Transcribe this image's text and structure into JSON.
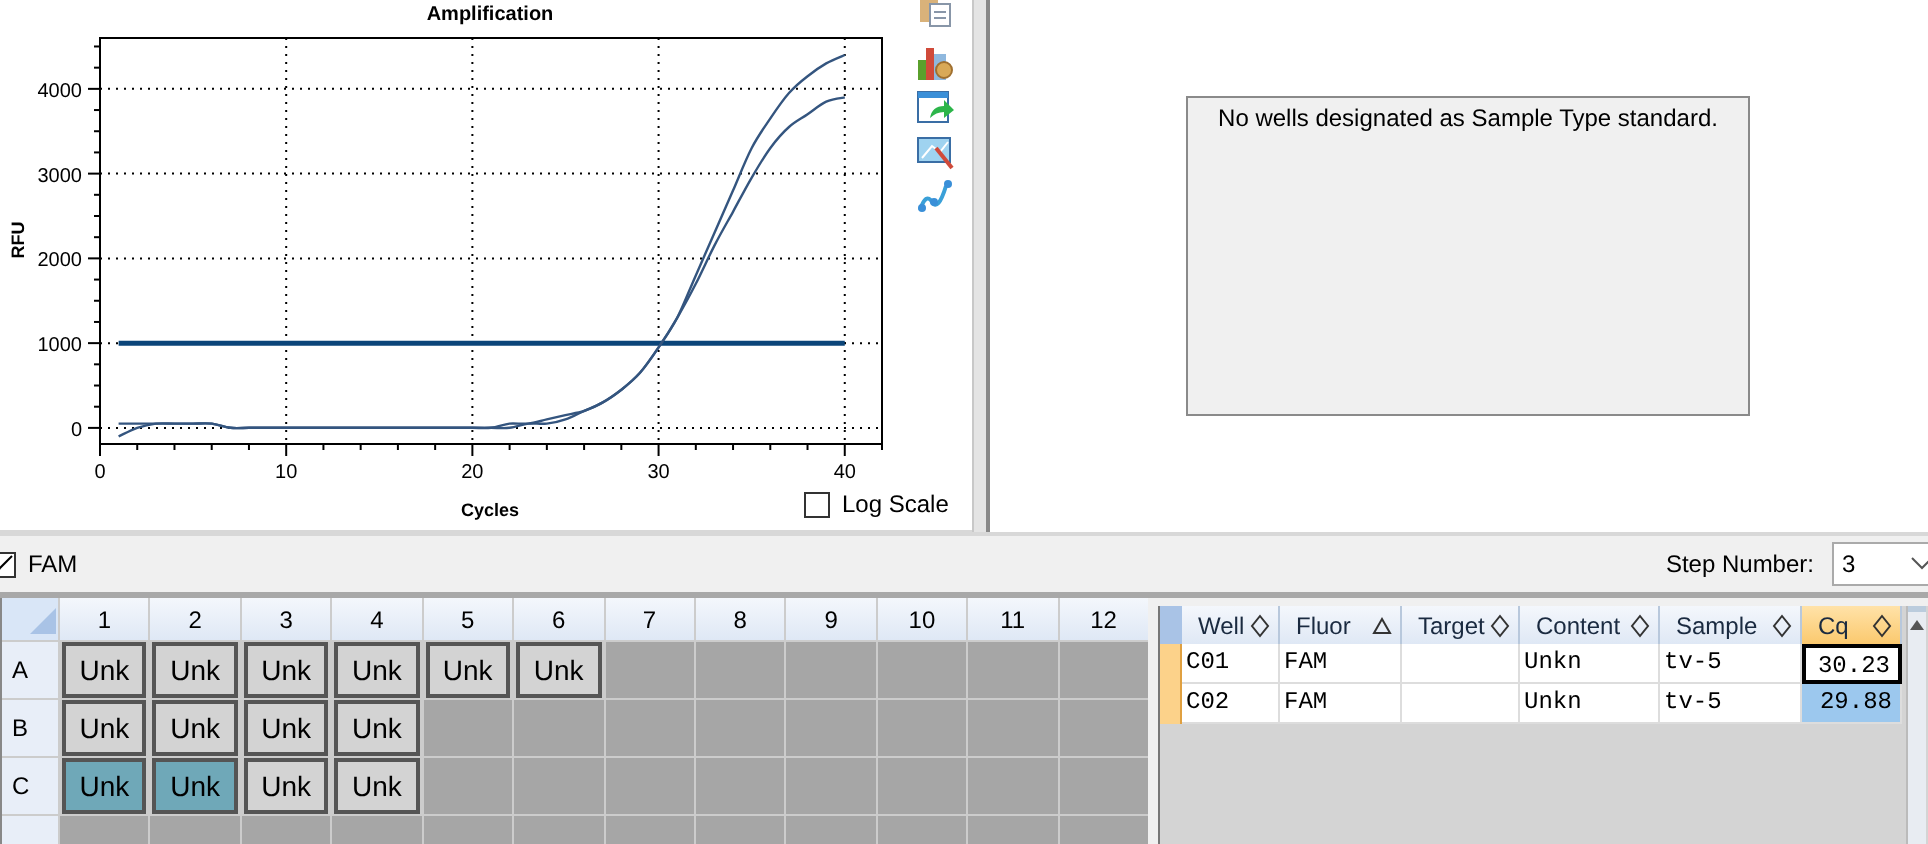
{
  "chart": {
    "log_scale": {
      "label": "Log Scale",
      "checked": false
    },
    "chart_data": {
      "type": "line",
      "title": "Amplification",
      "xlabel": "Cycles",
      "ylabel": "RFU",
      "grid": true,
      "x": [
        1,
        2,
        3,
        4,
        5,
        6,
        7,
        8,
        9,
        10,
        11,
        12,
        13,
        14,
        15,
        16,
        17,
        18,
        19,
        20,
        21,
        22,
        23,
        24,
        25,
        26,
        27,
        28,
        29,
        30,
        31,
        32,
        33,
        34,
        35,
        36,
        37,
        38,
        39,
        40
      ],
      "series": [
        {
          "color": "#34557f",
          "values": [
            -100,
            0,
            50,
            50,
            50,
            50,
            0,
            0,
            0,
            0,
            0,
            0,
            0,
            0,
            0,
            0,
            0,
            0,
            0,
            0,
            0,
            0,
            50,
            50,
            100,
            200,
            300,
            450,
            650,
            950,
            1300,
            1800,
            2300,
            2800,
            3300,
            3650,
            3950,
            4150,
            4300,
            4400
          ]
        },
        {
          "color": "#34557f",
          "values": [
            50,
            50,
            50,
            50,
            50,
            50,
            0,
            0,
            0,
            0,
            0,
            0,
            0,
            0,
            0,
            0,
            0,
            0,
            0,
            0,
            0,
            50,
            50,
            100,
            150,
            200,
            300,
            450,
            650,
            950,
            1300,
            1700,
            2150,
            2550,
            2950,
            3300,
            3550,
            3700,
            3850,
            3900
          ]
        }
      ],
      "xlim": [
        0,
        42
      ],
      "ylim": [
        -190,
        4600
      ],
      "xticks": [
        0,
        10,
        20,
        30,
        40
      ],
      "yticks": [
        0,
        1000,
        2000,
        3000,
        4000
      ],
      "ref_lines": [
        {
          "axis": "y",
          "value": 1000
        }
      ]
    }
  },
  "standard_curve": {
    "message": "No wells designated as Sample Type standard."
  },
  "fluor_filter": {
    "label": "FAM",
    "checked": true
  },
  "step": {
    "label": "Step Number:",
    "value": "3"
  },
  "plate": {
    "columns": [
      "1",
      "2",
      "3",
      "4",
      "5",
      "6",
      "7",
      "8",
      "9",
      "10",
      "11",
      "12"
    ],
    "rows": [
      {
        "label": "A",
        "wells": [
          {
            "content": "Unk",
            "selected": false
          },
          {
            "content": "Unk",
            "selected": false
          },
          {
            "content": "Unk",
            "selected": false
          },
          {
            "content": "Unk",
            "selected": false
          },
          {
            "content": "Unk",
            "selected": false
          },
          {
            "content": "Unk",
            "selected": false
          }
        ]
      },
      {
        "label": "B",
        "wells": [
          {
            "content": "Unk",
            "selected": false
          },
          {
            "content": "Unk",
            "selected": false
          },
          {
            "content": "Unk",
            "selected": false
          },
          {
            "content": "Unk",
            "selected": false
          }
        ]
      },
      {
        "label": "C",
        "wells": [
          {
            "content": "Unk",
            "selected": true
          },
          {
            "content": "Unk",
            "selected": true
          },
          {
            "content": "Unk",
            "selected": false
          },
          {
            "content": "Unk",
            "selected": false
          }
        ]
      },
      {
        "wells": []
      }
    ]
  },
  "table": {
    "columns": [
      {
        "label": "Well",
        "sort_ascending": false,
        "selected": false
      },
      {
        "label": "Fluor",
        "sort_ascending": true,
        "selected": false
      },
      {
        "label": "Target",
        "sort_ascending": false,
        "selected": false
      },
      {
        "label": "Content",
        "sort_ascending": false,
        "selected": false
      },
      {
        "label": "Sample",
        "sort_ascending": false,
        "selected": false
      },
      {
        "label": "Cq",
        "sort_ascending": false,
        "selected": true
      }
    ],
    "rows": [
      {
        "cells": [
          "C01",
          "FAM",
          null,
          "Unkn",
          "tv-5",
          "30.23"
        ],
        "cq_focused": true,
        "cq_selected": false
      },
      {
        "cells": [
          "C02",
          "FAM",
          null,
          "Unkn",
          "tv-5",
          "29.88"
        ],
        "cq_focused": false,
        "cq_selected": true
      }
    ]
  }
}
